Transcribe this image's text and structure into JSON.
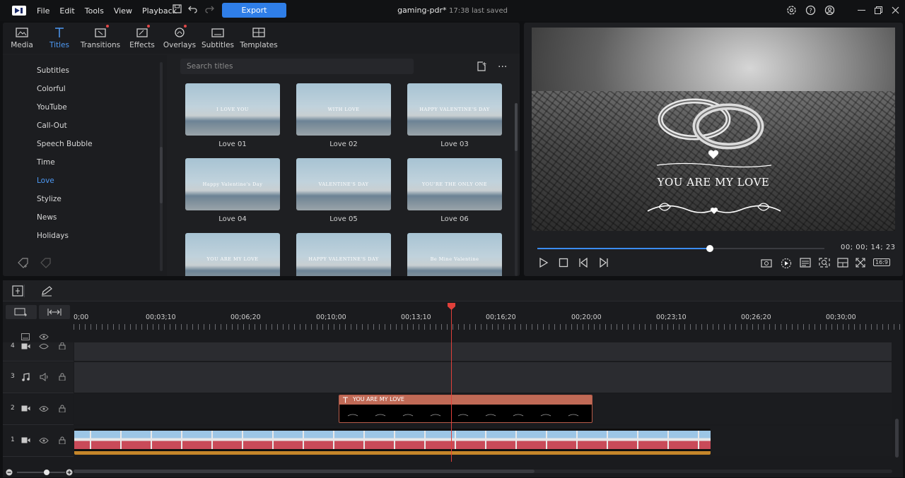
{
  "menu": [
    "File",
    "Edit",
    "Tools",
    "View",
    "Playback"
  ],
  "export_label": "Export",
  "project": {
    "name": "gaming-pdr*",
    "saved": "17:38 last saved"
  },
  "tabs": [
    {
      "label": "Media",
      "icon": "media-icon",
      "dot": false
    },
    {
      "label": "Titles",
      "icon": "titles-icon",
      "dot": false
    },
    {
      "label": "Transitions",
      "icon": "transitions-icon",
      "dot": true
    },
    {
      "label": "Effects",
      "icon": "effects-icon",
      "dot": true
    },
    {
      "label": "Overlays",
      "icon": "overlays-icon",
      "dot": true
    },
    {
      "label": "Subtitles",
      "icon": "subtitles-icon",
      "dot": false
    },
    {
      "label": "Templates",
      "icon": "templates-icon",
      "dot": false
    }
  ],
  "categories": [
    "Subtitles",
    "Colorful",
    "YouTube",
    "Call-Out",
    "Speech Bubble",
    "Time",
    "Love",
    "Stylize",
    "News",
    "Holidays"
  ],
  "active_category": "Love",
  "search_placeholder": "Search titles",
  "thumbnails": [
    {
      "label": "Love 01",
      "text": "I LOVE YOU"
    },
    {
      "label": "Love 02",
      "text": "WITH LOVE"
    },
    {
      "label": "Love 03",
      "text": "HAPPY VALENTINE'S DAY"
    },
    {
      "label": "Love 04",
      "text": "Happy Valentine's Day"
    },
    {
      "label": "Love 05",
      "text": "VALENTINE'S DAY"
    },
    {
      "label": "Love 06",
      "text": "YOU'RE THE ONLY ONE"
    },
    {
      "label": "",
      "text": "YOU ARE MY LOVE"
    },
    {
      "label": "",
      "text": "HAPPY VALENTINE'S DAY"
    },
    {
      "label": "",
      "text": "Be Mine Valentine"
    }
  ],
  "preview": {
    "overlay_text": "YOU ARE MY LOVE",
    "timecode": "00; 00; 14; 23",
    "progress": 0.6,
    "aspect": "16:9"
  },
  "ruler_labels": [
    "0;00",
    "00;03;10",
    "00;06;20",
    "00;10;00",
    "00;13;10",
    "00;16;20",
    "00;20;00",
    "00;23;10",
    "00;26;20",
    "00;30;00"
  ],
  "tracks": [
    {
      "num": "4"
    },
    {
      "num": "3"
    },
    {
      "num": "2"
    },
    {
      "num": "1"
    }
  ],
  "title_clip": "YOU ARE MY LOVE",
  "colors": {
    "accent": "#2f7ee8",
    "title_clip": "#c06a56",
    "playhead": "#e0403a",
    "video_clip": "#c5862a"
  }
}
